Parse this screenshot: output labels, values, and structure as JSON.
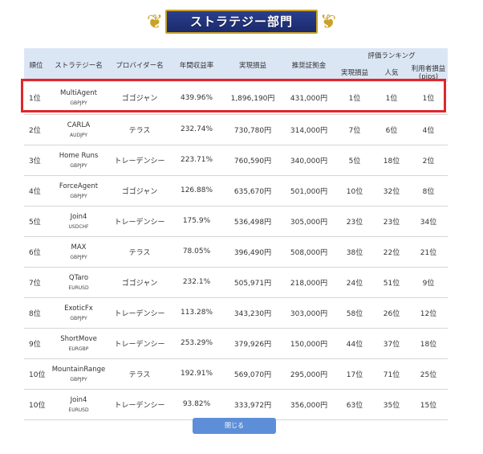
{
  "banner": {
    "title": "ストラテジー部門"
  },
  "table": {
    "headers": {
      "rank": "順位",
      "strategy": "ストラテジー名",
      "provider": "プロバイダー名",
      "annual_return": "年間収益率",
      "realized_pl": "実現損益",
      "recommended_margin": "推奨証拠金",
      "rating_group": "評価ランキング",
      "rating_realized": "実現損益",
      "rating_popularity": "人気",
      "rating_user_pl": "利用者損益",
      "rating_user_pl_unit": "(pips)"
    },
    "rows": [
      {
        "rank": "1位",
        "name": "MultiAgent",
        "pair": "GBPJPY",
        "provider": "ゴゴジャン",
        "ret": "439.96%",
        "pl": "1,896,190円",
        "margin": "431,000円",
        "r1": "1位",
        "r2": "1位",
        "r3": "1位"
      },
      {
        "rank": "2位",
        "name": "CARLA",
        "pair": "AUDJPY",
        "provider": "テラス",
        "ret": "232.74%",
        "pl": "730,780円",
        "margin": "314,000円",
        "r1": "7位",
        "r2": "6位",
        "r3": "4位"
      },
      {
        "rank": "3位",
        "name": "Home Runs",
        "pair": "GBPJPY",
        "provider": "トレーデンシー",
        "ret": "223.71%",
        "pl": "760,590円",
        "margin": "340,000円",
        "r1": "5位",
        "r2": "18位",
        "r3": "2位"
      },
      {
        "rank": "4位",
        "name": "ForceAgent",
        "pair": "GBPJPY",
        "provider": "ゴゴジャン",
        "ret": "126.88%",
        "pl": "635,670円",
        "margin": "501,000円",
        "r1": "10位",
        "r2": "32位",
        "r3": "8位"
      },
      {
        "rank": "5位",
        "name": "Join4",
        "pair": "USDCHF",
        "provider": "トレーデンシー",
        "ret": "175.9%",
        "pl": "536,498円",
        "margin": "305,000円",
        "r1": "23位",
        "r2": "23位",
        "r3": "34位"
      },
      {
        "rank": "6位",
        "name": "MAX",
        "pair": "GBPJPY",
        "provider": "テラス",
        "ret": "78.05%",
        "pl": "396,490円",
        "margin": "508,000円",
        "r1": "38位",
        "r2": "22位",
        "r3": "21位"
      },
      {
        "rank": "7位",
        "name": "QTaro",
        "pair": "EURUSD",
        "provider": "ゴゴジャン",
        "ret": "232.1%",
        "pl": "505,971円",
        "margin": "218,000円",
        "r1": "24位",
        "r2": "51位",
        "r3": "9位"
      },
      {
        "rank": "8位",
        "name": "ExoticFx",
        "pair": "GBPJPY",
        "provider": "トレーデンシー",
        "ret": "113.28%",
        "pl": "343,230円",
        "margin": "303,000円",
        "r1": "58位",
        "r2": "26位",
        "r3": "12位"
      },
      {
        "rank": "9位",
        "name": "ShortMove",
        "pair": "EURGBP",
        "provider": "トレーデンシー",
        "ret": "253.29%",
        "pl": "379,926円",
        "margin": "150,000円",
        "r1": "44位",
        "r2": "37位",
        "r3": "18位"
      },
      {
        "rank": "10位",
        "name": "MountainRange",
        "pair": "GBPJPY",
        "provider": "テラス",
        "ret": "192.91%",
        "pl": "569,070円",
        "margin": "295,000円",
        "r1": "17位",
        "r2": "71位",
        "r3": "25位"
      },
      {
        "rank": "10位",
        "name": "Join4",
        "pair": "EURUSD",
        "provider": "トレーデンシー",
        "ret": "93.82%",
        "pl": "333,972円",
        "margin": "356,000円",
        "r1": "63位",
        "r2": "35位",
        "r3": "15位"
      }
    ]
  },
  "close_button": {
    "label": "閉じる"
  },
  "colors": {
    "header_bg": "#dbe6f5",
    "highlight": "#e0262b",
    "button": "#5d8fd8",
    "banner": "#1b2a6b"
  }
}
